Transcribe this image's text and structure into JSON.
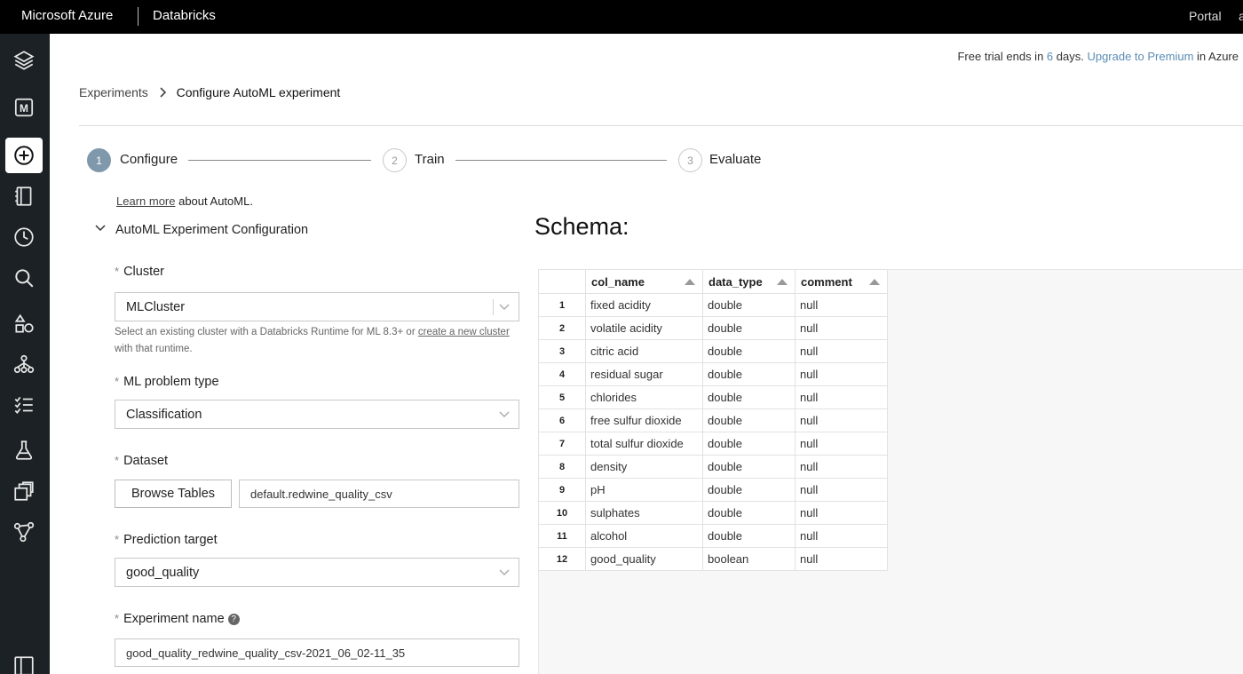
{
  "topbar": {
    "brand": "Microsoft Azure",
    "product": "Databricks",
    "portal": "Portal",
    "user": "a"
  },
  "sidebar": {
    "items": [
      {
        "name": "layers-icon"
      },
      {
        "name": "ml-persona-icon"
      },
      {
        "name": "create-icon",
        "active": true
      },
      {
        "name": "workspace-icon"
      },
      {
        "name": "recents-icon"
      },
      {
        "name": "search-icon"
      },
      {
        "name": "data-icon"
      },
      {
        "name": "clusters-icon"
      },
      {
        "name": "jobs-icon"
      },
      {
        "name": "experiments-icon"
      },
      {
        "name": "feature-store-icon"
      },
      {
        "name": "models-icon"
      },
      {
        "name": "panel-toggle-icon"
      }
    ]
  },
  "trial": {
    "prefix": "Free trial ends in ",
    "days": "6",
    "suffix": " days. ",
    "upgrade": "Upgrade to Premium",
    "tail": " in Azure"
  },
  "breadcrumb": {
    "parent": "Experiments",
    "current": "Configure AutoML experiment"
  },
  "steps": [
    {
      "num": "1",
      "label": "Configure",
      "active": true
    },
    {
      "num": "2",
      "label": "Train",
      "active": false
    },
    {
      "num": "3",
      "label": "Evaluate",
      "active": false
    }
  ],
  "learn": {
    "link": "Learn more",
    "text": " about AutoML."
  },
  "section": {
    "title": "AutoML Experiment Configuration"
  },
  "form": {
    "required_mark": "*",
    "cluster": {
      "label": "Cluster",
      "value": "MLCluster",
      "help_prefix": "Select an existing cluster with a Databricks Runtime for ML 8.3+ or ",
      "help_link": "create a new cluster",
      "help_suffix": " with that runtime."
    },
    "problem_type": {
      "label": "ML problem type",
      "value": "Classification"
    },
    "dataset": {
      "label": "Dataset",
      "button": "Browse Tables",
      "value": "default.redwine_quality_csv"
    },
    "target": {
      "label": "Prediction target",
      "value": "good_quality"
    },
    "experiment_name": {
      "label": "Experiment name",
      "help_icon": "?",
      "value": "good_quality_redwine_quality_csv-2021_06_02-11_35"
    }
  },
  "schema": {
    "title": "Schema:",
    "headers": [
      "col_name",
      "data_type",
      "comment"
    ],
    "rows": [
      [
        "1",
        "fixed acidity",
        "double",
        "null"
      ],
      [
        "2",
        "volatile acidity",
        "double",
        "null"
      ],
      [
        "3",
        "citric acid",
        "double",
        "null"
      ],
      [
        "4",
        "residual sugar",
        "double",
        "null"
      ],
      [
        "5",
        "chlorides",
        "double",
        "null"
      ],
      [
        "6",
        "free sulfur dioxide",
        "double",
        "null"
      ],
      [
        "7",
        "total sulfur dioxide",
        "double",
        "null"
      ],
      [
        "8",
        "density",
        "double",
        "null"
      ],
      [
        "9",
        "pH",
        "double",
        "null"
      ],
      [
        "10",
        "sulphates",
        "double",
        "null"
      ],
      [
        "11",
        "alcohol",
        "double",
        "null"
      ],
      [
        "12",
        "good_quality",
        "boolean",
        "null"
      ]
    ]
  }
}
